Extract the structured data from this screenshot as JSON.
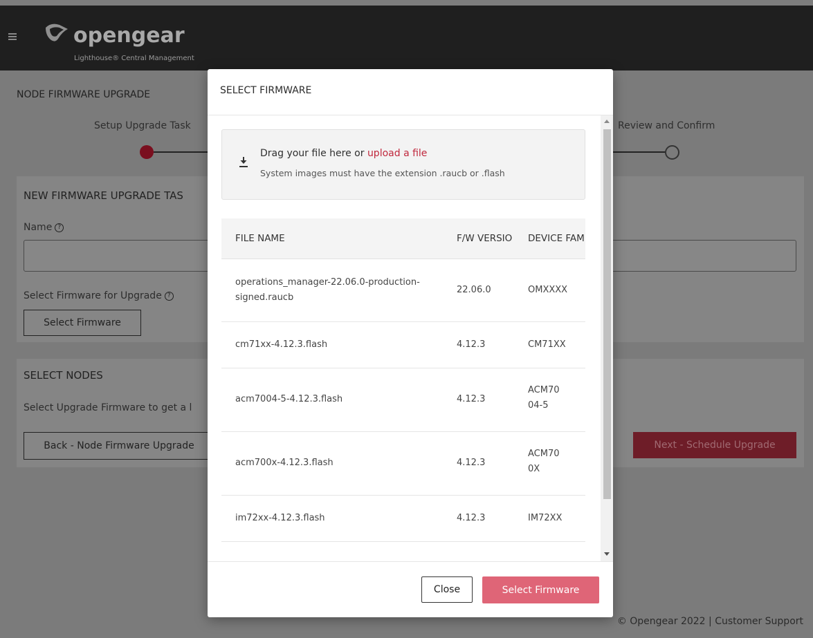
{
  "app": {
    "logo_text": "opengear",
    "logo_subtitle": "Lighthouse® Central Management"
  },
  "page": {
    "title": "NODE FIRMWARE UPGRADE",
    "steps": [
      {
        "label": "Setup Upgrade Task",
        "state": "active"
      },
      {
        "label": "Review and Confirm",
        "state": "inactive"
      }
    ],
    "new_task": {
      "title": "NEW FIRMWARE UPGRADE TAS",
      "name_label": "Name",
      "firmware_label": "Select Firmware for Upgrade",
      "select_firmware_button": "Select Firmware"
    },
    "select_nodes": {
      "title": "SELECT NODES",
      "hint": "Select Upgrade Firmware to get a l",
      "back_button": "Back - Node Firmware Upgrade",
      "next_button": "Next - Schedule Upgrade"
    },
    "footer": "© Opengear 2022 | Customer Support"
  },
  "modal": {
    "title": "SELECT FIRMWARE",
    "dropzone": {
      "main_text": "Drag your file here or ",
      "link_text": "upload a file",
      "sub_text": "System images must have the extension .raucb or .flash"
    },
    "table": {
      "headers": [
        "FILE NAME",
        "F/W VERSIO",
        "DEVICE FAMI"
      ],
      "rows": [
        {
          "file": "operations_manager-22.06.0-production-signed.raucb",
          "version": "22.06.0",
          "family": "OMXXXX"
        },
        {
          "file": "cm71xx-4.12.3.flash",
          "version": "4.12.3",
          "family": "CM71XX"
        },
        {
          "file": "acm7004-5-4.12.3.flash",
          "version": "4.12.3",
          "family": "ACM7004-5"
        },
        {
          "file": "acm700x-4.12.3.flash",
          "version": "4.12.3",
          "family": "ACM700X"
        },
        {
          "file": "im72xx-4.12.3.flash",
          "version": "4.12.3",
          "family": "IM72XX"
        }
      ]
    },
    "close_button": "Close",
    "select_button": "Select Firmware"
  },
  "colors": {
    "accent": "#df6577",
    "link": "#c0283d",
    "active_step": "#7a0f1f"
  }
}
